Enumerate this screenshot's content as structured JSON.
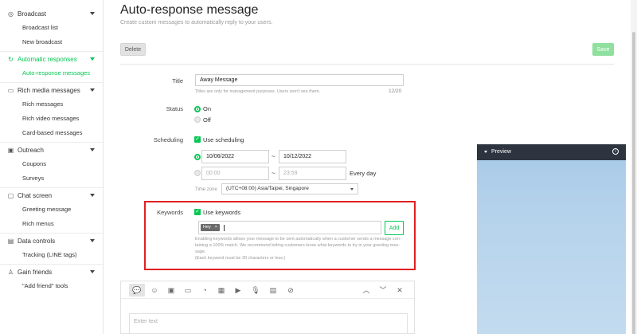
{
  "sidebar": {
    "groups": [
      {
        "label": "Broadcast",
        "icon": "broadcast-icon",
        "items": [
          "Broadcast list",
          "New broadcast"
        ]
      },
      {
        "label": "Automatic responses",
        "icon": "auto-response-icon",
        "active": true,
        "items": [
          "Auto-response messages"
        ]
      },
      {
        "label": "Rich media messages",
        "icon": "rich-media-icon",
        "items": [
          "Rich messages",
          "Rich video messages",
          "Card-based messages"
        ]
      },
      {
        "label": "Outreach",
        "icon": "outreach-icon",
        "items": [
          "Coupons",
          "Surveys"
        ]
      },
      {
        "label": "Chat screen",
        "icon": "chat-screen-icon",
        "items": [
          "Greeting message",
          "Rich menus"
        ]
      },
      {
        "label": "Data controls",
        "icon": "data-controls-icon",
        "items": [
          "Tracking (LINE tags)"
        ]
      },
      {
        "label": "Gain friends",
        "icon": "gain-friends-icon",
        "items": [
          "\"Add friend\" tools"
        ]
      }
    ]
  },
  "page": {
    "title": "Auto-response message",
    "subtitle": "Create custom messages to automatically reply to your users.",
    "delete_label": "Delete",
    "save_label": "Save"
  },
  "form": {
    "title_label": "Title",
    "title_value": "Away Message",
    "title_helper": "Titles are only for management purposes. Users won't see them.",
    "title_counter": "12/20",
    "status_label": "Status",
    "status_on": "On",
    "status_off": "Off",
    "scheduling_label": "Scheduling",
    "use_scheduling": "Use scheduling",
    "date_start": "10/06/2022",
    "date_end": "10/12/2022",
    "time_start_placeholder": "00:00",
    "time_end_placeholder": "23:59",
    "every_day": "Every day",
    "time_zone_label": "Time zone",
    "time_zone_value": "(UTC+08:00) Asia/Taipei, Singapore",
    "keywords_label": "Keywords",
    "use_keywords": "Use keywords",
    "keyword_tag": "Hey",
    "add_label": "Add",
    "keywords_help_1": "Enabling keywords allows your message to be sent automatically when a customer sends a message con-",
    "keywords_help_2": "taining a 100% match. We recommend letting customers know what keywords to try in your greeting mes-",
    "keywords_help_3": "sage.",
    "keywords_help_4": "(Each keyword must be 30 characters or less.)"
  },
  "editor": {
    "placeholder": "Enter text",
    "tools": [
      "text-bubble-icon",
      "emoji-icon",
      "image-icon",
      "card-icon",
      "sticker-icon",
      "video-icon",
      "play-icon",
      "microphone-icon",
      "document-icon",
      "coupon-icon"
    ],
    "controls": [
      "chevron-up-icon",
      "chevron-down-icon",
      "close-icon"
    ]
  },
  "preview": {
    "title": "Preview"
  }
}
